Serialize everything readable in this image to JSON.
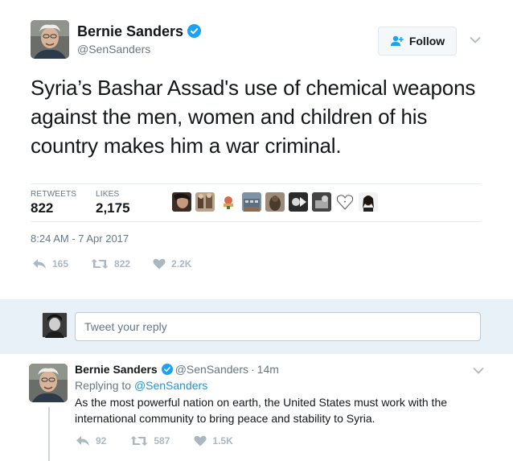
{
  "tweet": {
    "author": {
      "name": "Bernie Sanders",
      "handle": "@SenSanders",
      "verified": true
    },
    "follow_label": "Follow",
    "text": "Syria’s Bashar Assad's use of chemical weapons against the men, women and children of his country makes him a war criminal.",
    "stats": {
      "retweets_label": "RETWEETS",
      "retweets_value": "822",
      "likes_label": "LIKES",
      "likes_value": "2,175"
    },
    "timestamp": "8:24 AM - 7 Apr 2017",
    "actions": {
      "reply_count": "165",
      "retweet_count": "822",
      "like_count": "2.2K"
    }
  },
  "reply_box": {
    "placeholder": "Tweet your reply"
  },
  "thread_reply": {
    "author_name": "Bernie Sanders",
    "handle": "@SenSanders",
    "separator": "·",
    "time": "14m",
    "replying_prefix": "Replying to",
    "replying_to": "@SenSanders",
    "text": "As the most powerful nation on earth, the United States must work with the international community to bring peace and stability to Syria.",
    "actions": {
      "reply_count": "92",
      "retweet_count": "587",
      "like_count": "1.5K"
    }
  },
  "colors": {
    "accent": "#1da1f2",
    "link": "#1b95e0",
    "muted": "#657786",
    "icon": "#aab8c2",
    "reply_bar_bg": "#e8f1f7"
  }
}
